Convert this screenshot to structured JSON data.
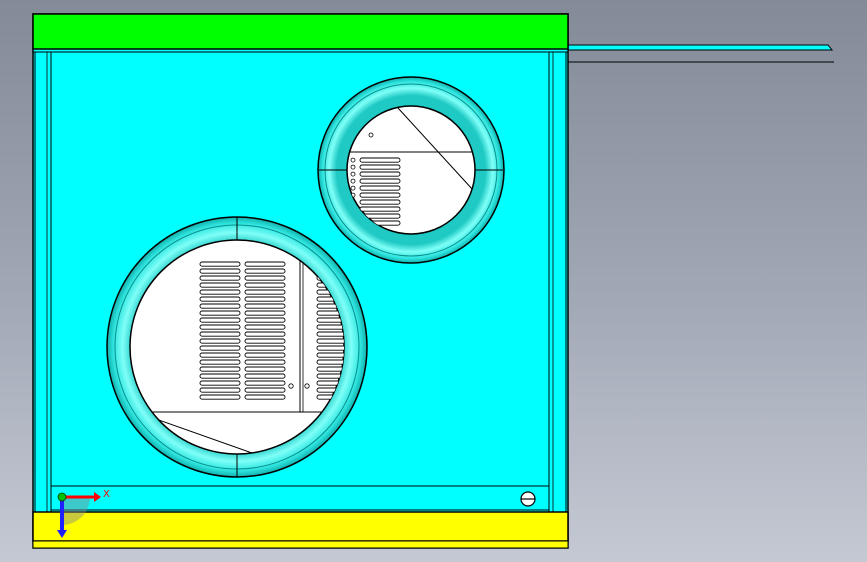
{
  "window": {
    "kind": "cad-model-viewport",
    "background_colors": [
      "#838b99",
      "#c4c9d3"
    ]
  },
  "model": {
    "colors": {
      "panel": "#00ffff",
      "top_rail": "#00ff00",
      "bottom_rail": "#ffff00",
      "duct_ring": "#2fe6e0",
      "opening": "#ffffff",
      "outline": "#000000"
    },
    "large_opening": {
      "vent_columns": 3,
      "vent_slots_per_column": 20
    },
    "small_opening": {
      "vent_slots": 10
    }
  },
  "triad": {
    "x_label": "X",
    "x_color": "#ff0000",
    "y_color": "#2020ff",
    "origin_color": "#00c000"
  }
}
